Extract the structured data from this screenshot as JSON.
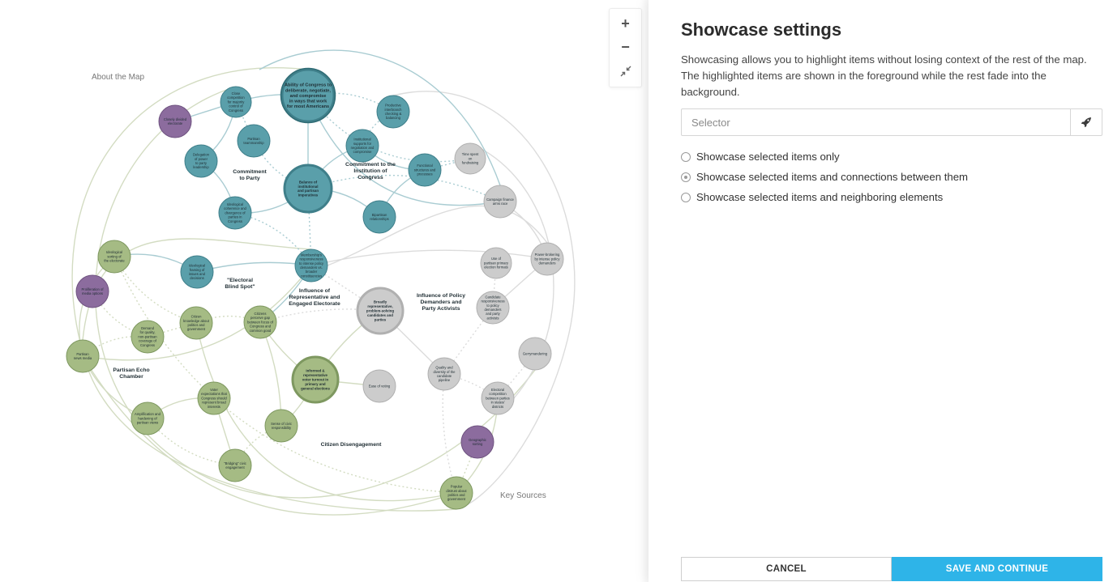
{
  "map": {
    "float_labels": {
      "about": "About the Map",
      "sources": "Key Sources"
    },
    "colors": {
      "teal": "#5a9faa",
      "teal_stroke": "#3f7f8a",
      "olive": "#a5bb84",
      "olive_stroke": "#7e9860",
      "gray": "#cccccc",
      "gray_stroke": "#b0b0b0",
      "purple": "#8c6c9e",
      "purple_stroke": "#6f5380",
      "line_teal": "#a9ccd2",
      "line_olive": "#d3dcc2",
      "line_gray": "#dcdcdc"
    },
    "group_labels": [
      "Commitment|to Party",
      "Commitment to the|Institution of|Congress",
      "\"Electoral|Blind Spot\"",
      "Influence of|Representative and|Engaged Electorate",
      "Influence of Policy|Demanders and|Party Activists",
      "Partisan Echo|Chamber",
      "Citizen Disengagement"
    ],
    "nodes": [
      "Ability of Congress to|deliberate, negotiate,|and compromise|in ways that work|for most Americans",
      "Close|competition|for majority|control of|Congress",
      "Closely divided|electorate",
      "Partisan|teammanship",
      "Delegation|of power|to party|leadership",
      "Productive|interbranch|checking &|balancing",
      "Institutional|supports for|negotiation and|compromise",
      "Functional|structures and|processes",
      "Time spent|on|fundraising",
      "Balance of|institutional|and partisan|imperatives",
      "Ideological|coherence and|divergence of|parties in|Congress",
      "Bipartisan|relationships",
      "Campaign finance|arms race",
      "Ideological|sorting of|the electorate",
      "Membership's|responsiveness|to intense policy|demanders vs.|broader|constituencies",
      "Ideological|framing of|issues and|decisions",
      "Proliferation of|media options",
      "Use of|partisan primary|election formats",
      "Power-brokering|by intense policy|demanders",
      "Broadly|representative,|problem-solving|candidates and|parties",
      "Candidate|responsiveness|to policy|demanders|and party|activists",
      "Citizen|knowledge about|politics and|government",
      "Citizens|perceive gap|between focus of|Congress and|common good",
      "Demand|for quality,|non-partisan|coverage of|Congress",
      "Partisan|news media",
      "Gerrymandering",
      "Quality and|diversity of the|candidate|pipeline",
      "Informed &|representative|voter turnout in|primary and|general elections",
      "Ease of voting",
      "Electoral|competition|between parties|in states/|districts",
      "Voter|expectations that|Congress should|represent broad|interests",
      "Amplification and|hardening of|partisan views",
      "Sense of civic|responsibility",
      "Geographic|sorting",
      "\"Bridging\" civic|engagement",
      "Popular|distrust about|politics and|government"
    ]
  },
  "zoom": {
    "zoom_in": "+",
    "zoom_out": "−"
  },
  "panel": {
    "title": "Showcase settings",
    "description": "Showcasing allows you to highlight items without losing context of the rest of the map. The highlighted items are shown in the foreground while the rest fade into the background.",
    "selector_placeholder": "Selector",
    "options": [
      {
        "label": "Showcase selected items only",
        "checked": false
      },
      {
        "label": "Showcase selected items and connections between them",
        "checked": true
      },
      {
        "label": "Showcase selected items and neighboring elements",
        "checked": false
      }
    ],
    "cancel_label": "CANCEL",
    "save_label": "SAVE AND CONTINUE"
  }
}
